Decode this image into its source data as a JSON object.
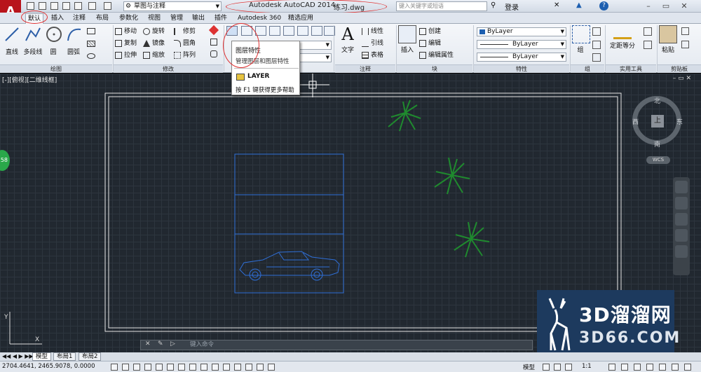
{
  "app": {
    "logo_letter": "A",
    "workspace": "草图与注释",
    "title": "Autodesk AutoCAD 2014",
    "file": "练习.dwg",
    "search_placeholder": "键入关键字或短语",
    "login": "登录"
  },
  "tabs": [
    "默认",
    "插入",
    "注释",
    "布局",
    "参数化",
    "视图",
    "管理",
    "输出",
    "插件",
    "Autodesk 360",
    "精选应用"
  ],
  "ribbon": {
    "draw": {
      "title": "绘图",
      "line": "直线",
      "polyline": "多段线",
      "circle": "圆",
      "arc": "圆弧"
    },
    "modify": {
      "title": "修改",
      "move": "移动",
      "rotate": "旋转",
      "trim": "修剪",
      "copy": "复制",
      "mirror": "镜像",
      "fillet": "圆角",
      "stretch": "拉伸",
      "scale": "缩放",
      "array": "阵列"
    },
    "annotation": {
      "title": "注释",
      "text": "文字",
      "linear": "线性",
      "leader": "引线",
      "table": "表格"
    },
    "block": {
      "title": "块",
      "insert": "插入",
      "create": "创建",
      "edit": "编辑",
      "edit_attr": "编辑属性"
    },
    "properties": {
      "title": "特性",
      "color": "ByLayer",
      "linetype": "ByLayer",
      "lineweight": "ByLayer"
    },
    "groups": {
      "title": "组",
      "group": "组"
    },
    "utilities": {
      "title": "实用工具",
      "measure": "定距等分"
    },
    "clipboard": {
      "title": "剪贴板",
      "paste": "粘贴"
    }
  },
  "tooltip": {
    "title": "图层特性",
    "description": "管理图层和图层特性",
    "command": "LAYER",
    "help": "按 F1 键获得更多帮助"
  },
  "viewport": {
    "label": "[-][俯视][二维线框]",
    "badge": "58",
    "compass": {
      "north": "北",
      "south": "南",
      "east": "东",
      "west": "西",
      "top": "上"
    },
    "wcs": "WCS"
  },
  "layout_tabs": [
    "模型",
    "布局1",
    "布局2"
  ],
  "command_line": {
    "placeholder": "键入命令"
  },
  "status": {
    "coords": "2704.4641, 2465.9078, 0.0000",
    "model": "模型",
    "scale": "1:1"
  },
  "watermark": {
    "line1": "3D溜溜网",
    "line2": "3D66.COM"
  },
  "colors": {
    "accent_red": "#e03030",
    "drawing_blue": "#2f6fd8",
    "plant_green": "#1f8a2e",
    "canvas_bg": "#212830"
  }
}
